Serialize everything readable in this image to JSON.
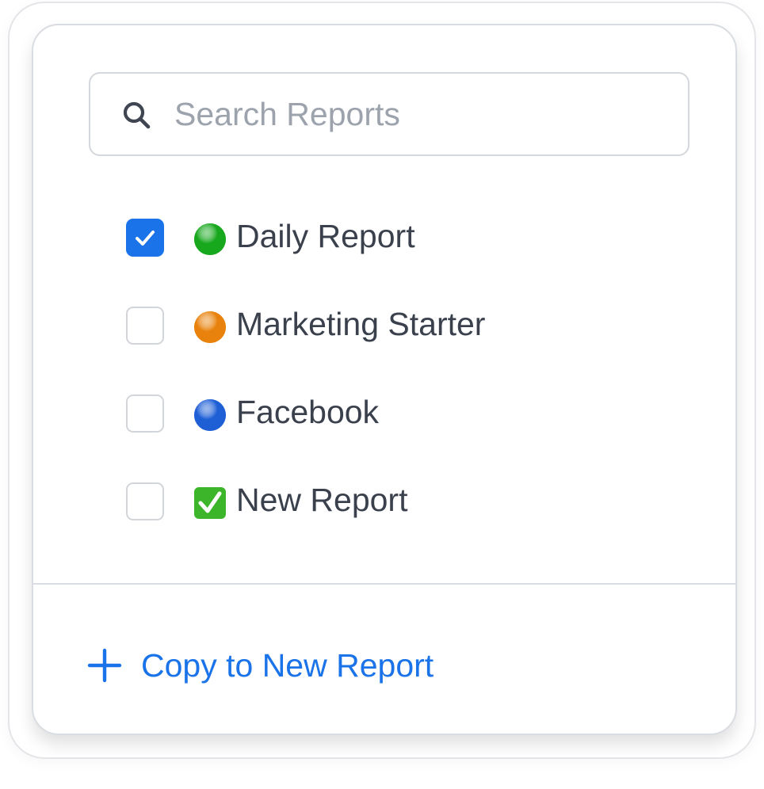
{
  "search": {
    "placeholder": "Search Reports",
    "value": "",
    "icon": "search-icon"
  },
  "reports": [
    {
      "label": "Daily Report",
      "checked": true,
      "emoji": "green-circle",
      "color": "#18a81e"
    },
    {
      "label": "Marketing Starter",
      "checked": false,
      "emoji": "orange-circle",
      "color": "#e8820c"
    },
    {
      "label": "Facebook",
      "checked": false,
      "emoji": "blue-circle",
      "color": "#1f5fd6"
    },
    {
      "label": "New Report",
      "checked": false,
      "emoji": "check-mark-button",
      "color": "#3cb52a"
    }
  ],
  "footer": {
    "copy_label": "Copy to New Report",
    "icon": "plus-icon"
  },
  "colors": {
    "accent": "#1a73e8",
    "text": "#3a414d",
    "placeholder": "#9ca3ad",
    "border": "#d9dce1"
  }
}
